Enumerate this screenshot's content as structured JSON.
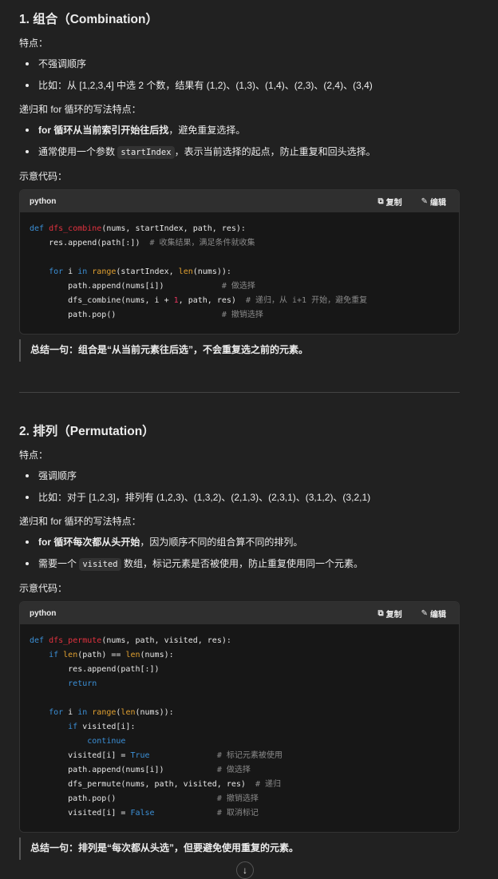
{
  "sections": [
    {
      "title": "1. 组合（Combination）",
      "features_label": "特点：",
      "features": [
        "不强调顺序",
        "比如：从 [1,2,3,4] 中选 2 个数，结果有 (1,2)、(1,3)、(1,4)、(2,3)、(2,4)、(3,4)"
      ],
      "recursion_label": "递归和 for 循环的写法特点：",
      "r1_bold": "for 循环从当前索引开始往后找",
      "r1_rest": "，避免重复选择。",
      "r2_pre": "通常使用一个参数 ",
      "r2_code": "startIndex",
      "r2_post": "，表示当前选择的起点，防止重复和回头选择。",
      "code_label": "示意代码：",
      "lang": "python",
      "copy": "复制",
      "edit": "编辑",
      "code": [
        [
          [
            "kw",
            "def "
          ],
          [
            "fn",
            "dfs_combine"
          ],
          [
            "",
            "(nums, startIndex, path, res):"
          ]
        ],
        [
          [
            "",
            "    res.append(path[:])  "
          ],
          [
            "cm",
            "# 收集结果，满足条件就收集"
          ]
        ],
        [],
        [
          [
            "kw",
            "    for "
          ],
          [
            "",
            "i "
          ],
          [
            "kw",
            "in "
          ],
          [
            "bi",
            "range"
          ],
          [
            "",
            "(startIndex, "
          ],
          [
            "bi",
            "len"
          ],
          [
            "",
            "(nums)):"
          ]
        ],
        [
          [
            "",
            "        path.append(nums[i])            "
          ],
          [
            "cm",
            "# 做选择"
          ]
        ],
        [
          [
            "",
            "        dfs_combine(nums, i + "
          ],
          [
            "nm",
            "1"
          ],
          [
            "",
            ", path, res)  "
          ],
          [
            "cm",
            "# 递归，从 i+1 开始，避免重复"
          ]
        ],
        [
          [
            "",
            "        path.pop()                      "
          ],
          [
            "cm",
            "# 撤销选择"
          ]
        ]
      ],
      "summary": "总结一句：组合是“从当前元素往后选”，不会重复选之前的元素。"
    },
    {
      "title": "2. 排列（Permutation）",
      "features_label": "特点：",
      "features": [
        "强调顺序",
        "比如：对于 [1,2,3]，排列有 (1,2,3)、(1,3,2)、(2,1,3)、(2,3,1)、(3,1,2)、(3,2,1)"
      ],
      "recursion_label": "递归和 for 循环的写法特点：",
      "r1_bold": "for 循环每次都从头开始",
      "r1_rest": "，因为顺序不同的组合算不同的排列。",
      "r2_pre": "需要一个 ",
      "r2_code": "visited",
      "r2_post": " 数组，标记元素是否被使用，防止重复使用同一个元素。",
      "code_label": "示意代码：",
      "lang": "python",
      "copy": "复制",
      "edit": "编辑",
      "code": [
        [
          [
            "kw",
            "def "
          ],
          [
            "fn",
            "dfs_permute"
          ],
          [
            "",
            "(nums, path, visited, res):"
          ]
        ],
        [
          [
            "kw",
            "    if "
          ],
          [
            "bi",
            "len"
          ],
          [
            "",
            "(path) == "
          ],
          [
            "bi",
            "len"
          ],
          [
            "",
            "(nums):"
          ]
        ],
        [
          [
            "",
            "        res.append(path[:])"
          ]
        ],
        [
          [
            "kw",
            "        return"
          ]
        ],
        [],
        [
          [
            "kw",
            "    for "
          ],
          [
            "",
            "i "
          ],
          [
            "kw",
            "in "
          ],
          [
            "bi",
            "range"
          ],
          [
            "",
            "("
          ],
          [
            "bi",
            "len"
          ],
          [
            "",
            "(nums)):"
          ]
        ],
        [
          [
            "kw",
            "        if "
          ],
          [
            "",
            "visited[i]:"
          ]
        ],
        [
          [
            "kw",
            "            continue"
          ]
        ],
        [
          [
            "",
            "        visited[i] = "
          ],
          [
            "cn",
            "True"
          ],
          [
            "",
            "              "
          ],
          [
            "cm",
            "# 标记元素被使用"
          ]
        ],
        [
          [
            "",
            "        path.append(nums[i])           "
          ],
          [
            "cm",
            "# 做选择"
          ]
        ],
        [
          [
            "",
            "        dfs_permute(nums, path, visited, res)  "
          ],
          [
            "cm",
            "# 递归"
          ]
        ],
        [
          [
            "",
            "        path.pop()                     "
          ],
          [
            "cm",
            "# 撤销选择"
          ]
        ],
        [
          [
            "",
            "        visited[i] = "
          ],
          [
            "cn",
            "False"
          ],
          [
            "",
            "             "
          ],
          [
            "cm",
            "# 取消标记"
          ]
        ]
      ],
      "summary": "总结一句：排列是“每次都从头选”，但要避免使用重复的元素。"
    }
  ],
  "scroll_down_icon": "arrow-down-icon"
}
